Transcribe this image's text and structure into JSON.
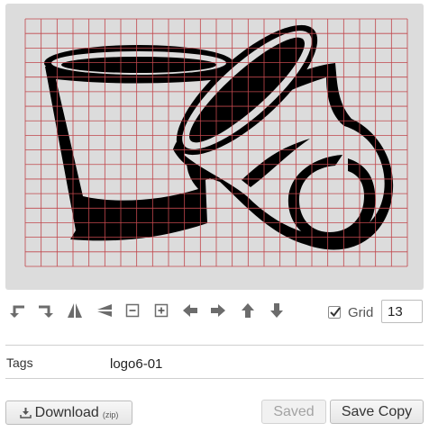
{
  "editor": {
    "grid_columns": 13,
    "grid_rows": 13,
    "grid_color": "#c0474c",
    "canvas_background": "#dcdcdc",
    "drawing_color": "#000000"
  },
  "toolbar": {
    "tools": [
      {
        "name": "rotate-left-icon"
      },
      {
        "name": "rotate-right-icon"
      },
      {
        "name": "flip-horizontal-icon"
      },
      {
        "name": "flip-vertical-icon"
      },
      {
        "name": "zoom-out-icon"
      },
      {
        "name": "zoom-in-icon"
      },
      {
        "name": "arrow-left-icon"
      },
      {
        "name": "arrow-right-icon"
      },
      {
        "name": "arrow-up-icon"
      },
      {
        "name": "arrow-down-icon"
      }
    ],
    "grid_label": "Grid",
    "grid_checked": true,
    "grid_value": "13"
  },
  "tags": {
    "label": "Tags",
    "value": "logo6-01"
  },
  "actions": {
    "download_label": "Download",
    "download_sub": "(zip)",
    "saved_label": "Saved",
    "save_copy_label": "Save Copy"
  }
}
